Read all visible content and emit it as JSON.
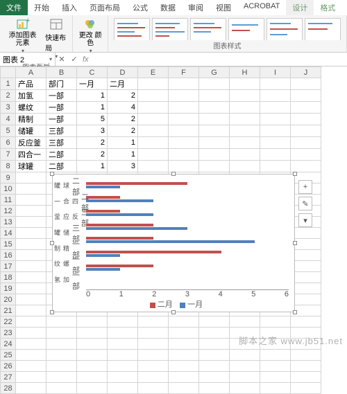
{
  "tabs": {
    "file": "文件",
    "home": "开始",
    "insert": "插入",
    "layout": "页面布局",
    "formula": "公式",
    "data": "数据",
    "review": "审阅",
    "view": "视图",
    "acrobat": "ACROBAT",
    "design": "设计",
    "format": "格式"
  },
  "toolbar": {
    "add_element": "添加图表\n元素",
    "quick_layout": "快速布局",
    "change_colors": "更改\n颜色",
    "group_layout": "图表布局",
    "group_styles": "图表样式"
  },
  "namebox": "图表 2",
  "headers": [
    "A",
    "B",
    "C",
    "D",
    "E",
    "F",
    "G",
    "H",
    "I",
    "J"
  ],
  "rows": [
    {
      "n": 1,
      "a": "产品",
      "b": "部门",
      "c": "一月",
      "d": "二月"
    },
    {
      "n": 2,
      "a": "加氢",
      "b": "一部",
      "c": "1",
      "d": "2"
    },
    {
      "n": 3,
      "a": "螺纹",
      "b": "一部",
      "c": "1",
      "d": "4"
    },
    {
      "n": 4,
      "a": "精制",
      "b": "一部",
      "c": "5",
      "d": "2"
    },
    {
      "n": 5,
      "a": "储罐",
      "b": "三部",
      "c": "3",
      "d": "2"
    },
    {
      "n": 6,
      "a": "反应釜",
      "b": "三部",
      "c": "2",
      "d": "1"
    },
    {
      "n": 7,
      "a": "四合一",
      "b": "二部",
      "c": "2",
      "d": "1"
    },
    {
      "n": 8,
      "a": "球罐",
      "b": "二部",
      "c": "1",
      "d": "3"
    }
  ],
  "empty_rows": [
    9,
    10,
    11,
    12,
    13,
    14,
    15,
    16,
    17,
    18,
    19,
    20,
    21,
    22,
    23,
    24,
    25,
    26,
    27,
    28
  ],
  "chart_data": {
    "type": "bar",
    "orientation": "horizontal",
    "categories": [
      "球罐 二部",
      "四合一 二部",
      "反应釜 三部",
      "储罐 三部",
      "精制 一部",
      "螺纹 一部",
      "加氢 一部"
    ],
    "series": [
      {
        "name": "二月",
        "color": "#c0504d",
        "values": [
          3,
          1,
          1,
          2,
          2,
          4,
          2
        ]
      },
      {
        "name": "一月",
        "color": "#4f81bd",
        "values": [
          1,
          2,
          2,
          3,
          5,
          1,
          1
        ]
      }
    ],
    "xlim": [
      0,
      6
    ],
    "xticks": [
      0,
      1,
      2,
      3,
      4,
      5,
      6
    ]
  },
  "ylab_pairs": [
    [
      "球罐",
      "二部"
    ],
    [
      "四合一",
      "二部"
    ],
    [
      "反应釜",
      "三部"
    ],
    [
      "储罐",
      "三部"
    ],
    [
      "精制",
      "一部"
    ],
    [
      "螺纹",
      "一部"
    ],
    [
      "加氢",
      "一部"
    ]
  ],
  "legend": {
    "s1": "二月",
    "s2": "一月"
  },
  "watermark": "脚本之家 www.jb51.net"
}
